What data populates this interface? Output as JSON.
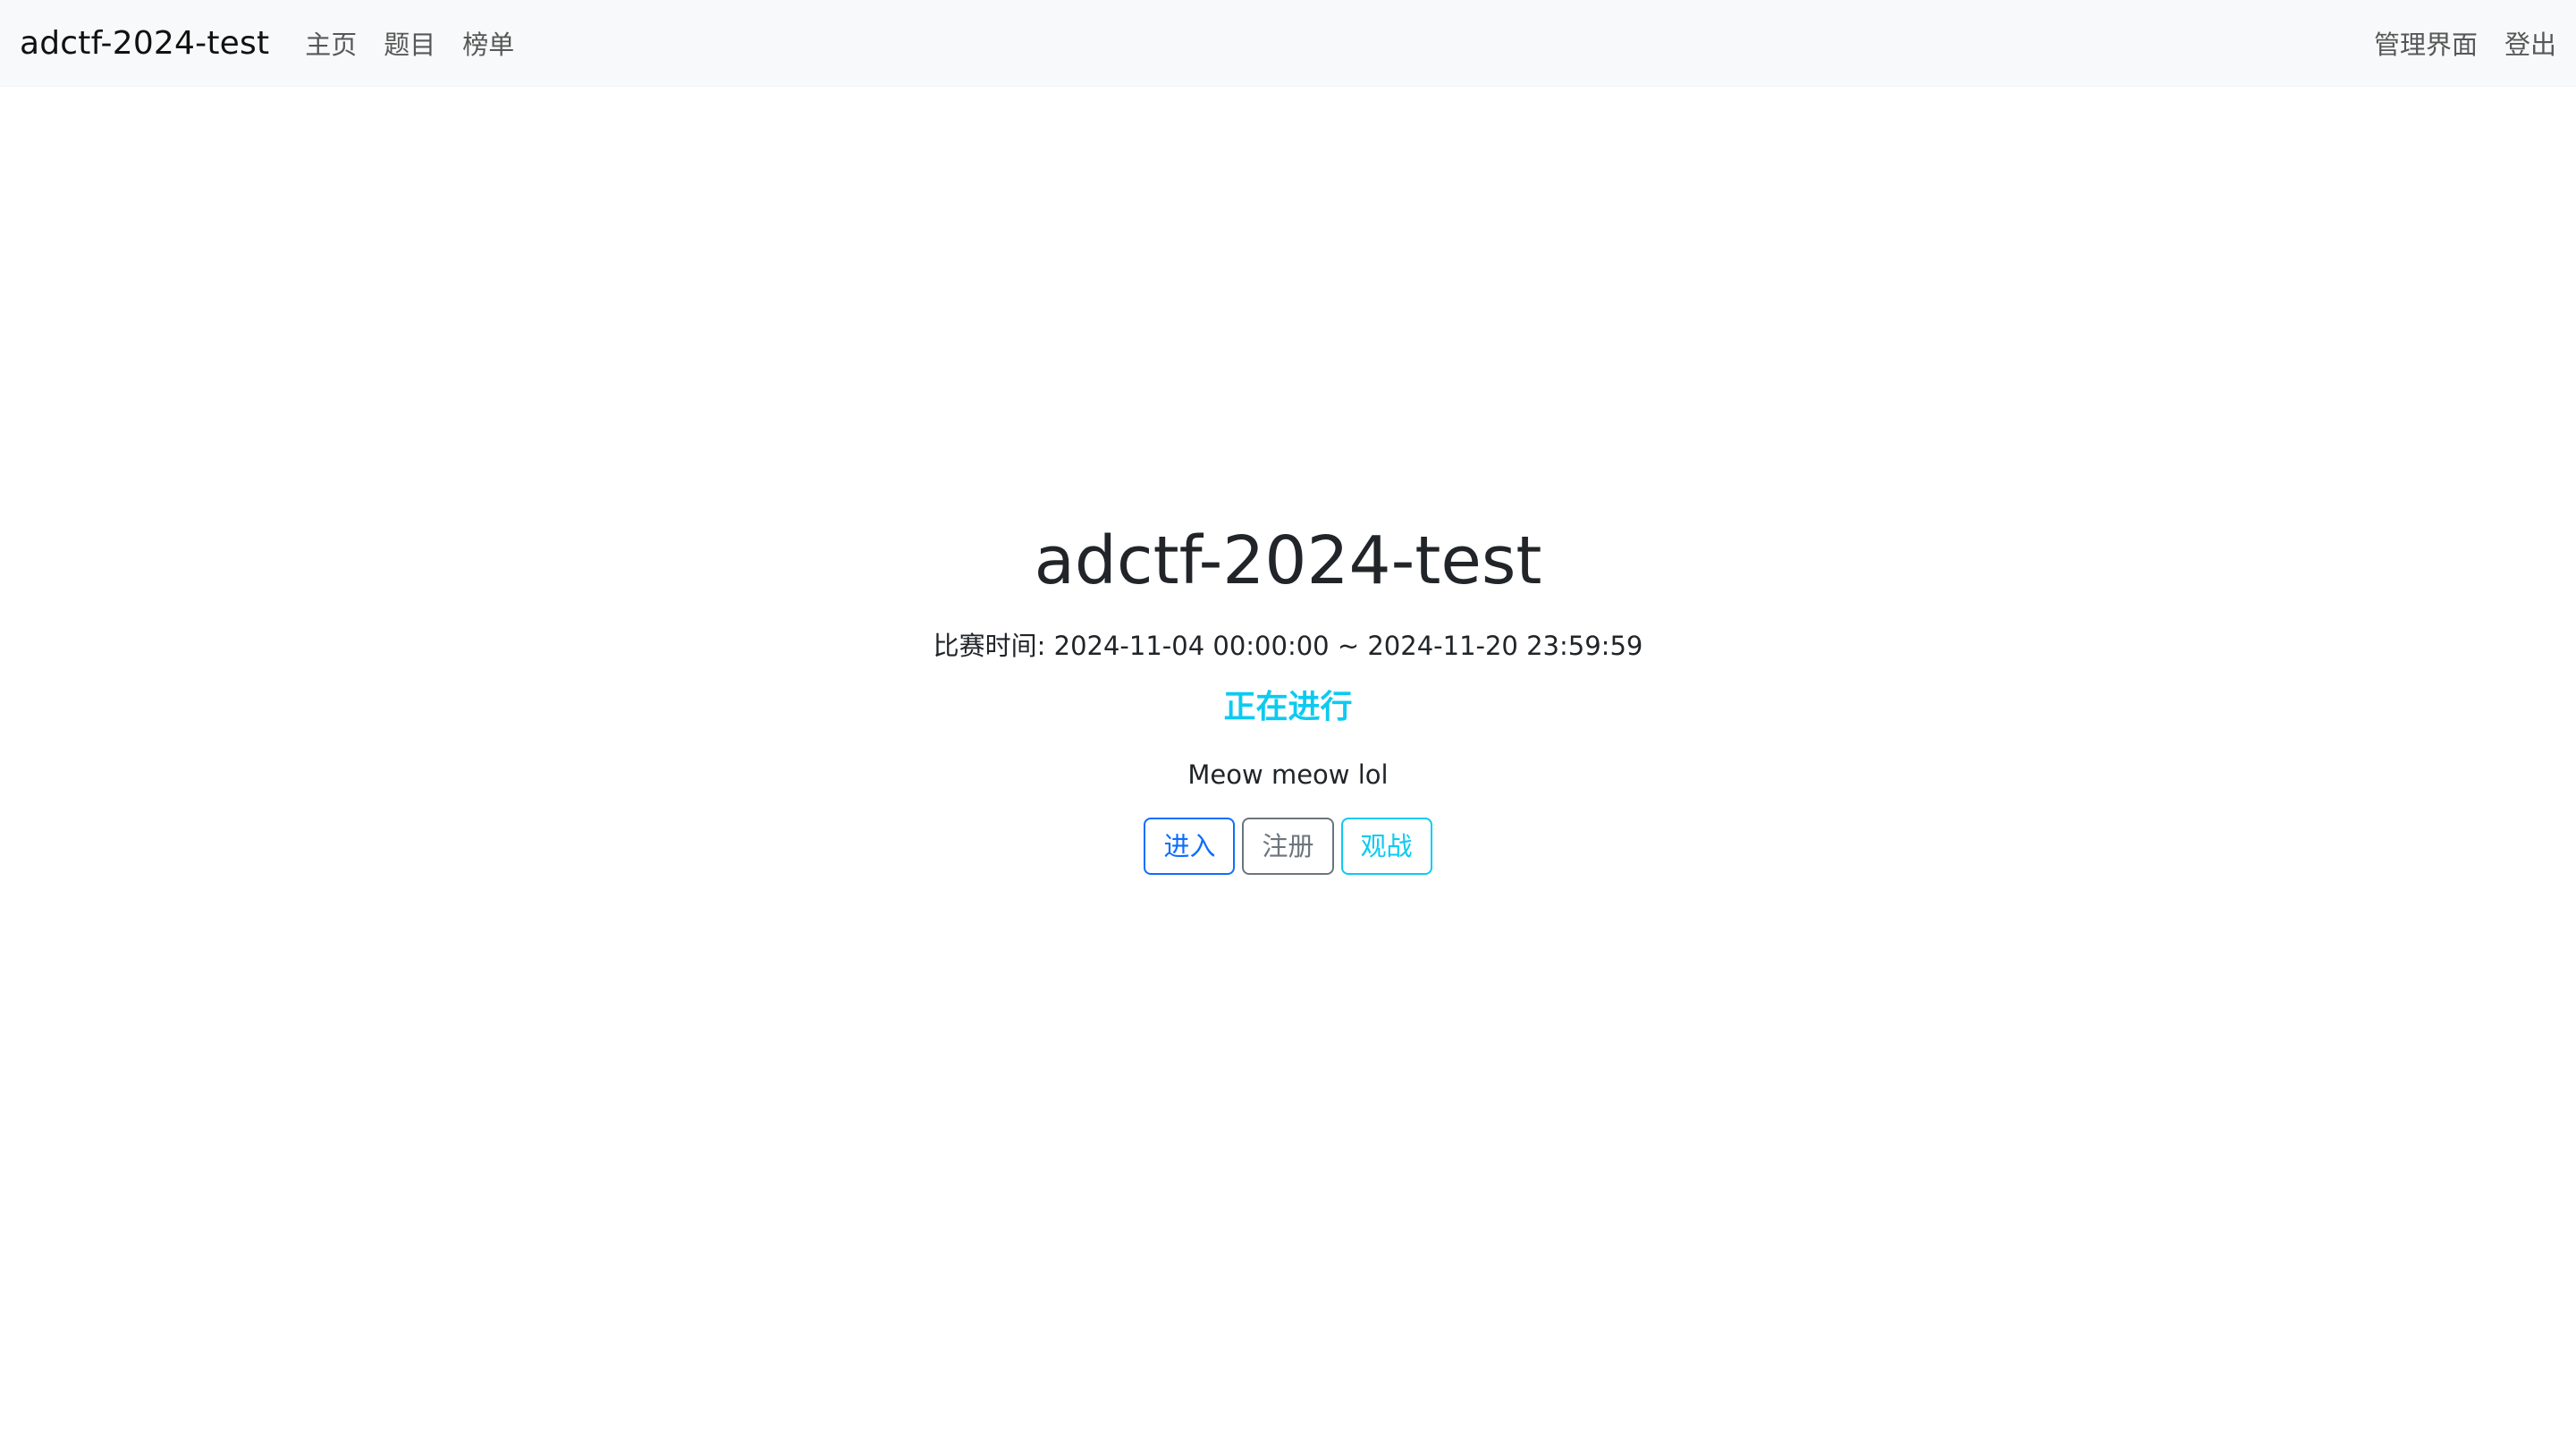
{
  "navbar": {
    "brand": "adctf-2024-test",
    "left_links": [
      "主页",
      "题目",
      "榜单"
    ],
    "right_links": [
      "管理界面",
      "登出"
    ]
  },
  "main": {
    "title": "adctf-2024-test",
    "time_label": "比赛时间: 2024-11-04 00:00:00 ~ 2024-11-20 23:59:59",
    "status": "正在进行",
    "description": "Meow meow lol",
    "buttons": {
      "enter": "进入",
      "register": "注册",
      "spectate": "观战"
    }
  },
  "colors": {
    "navbar_bg": "#f8f9fa",
    "status": "#0dcaf0",
    "primary": "#0d6efd",
    "secondary": "#6c757d",
    "info": "#0dcaf0"
  }
}
